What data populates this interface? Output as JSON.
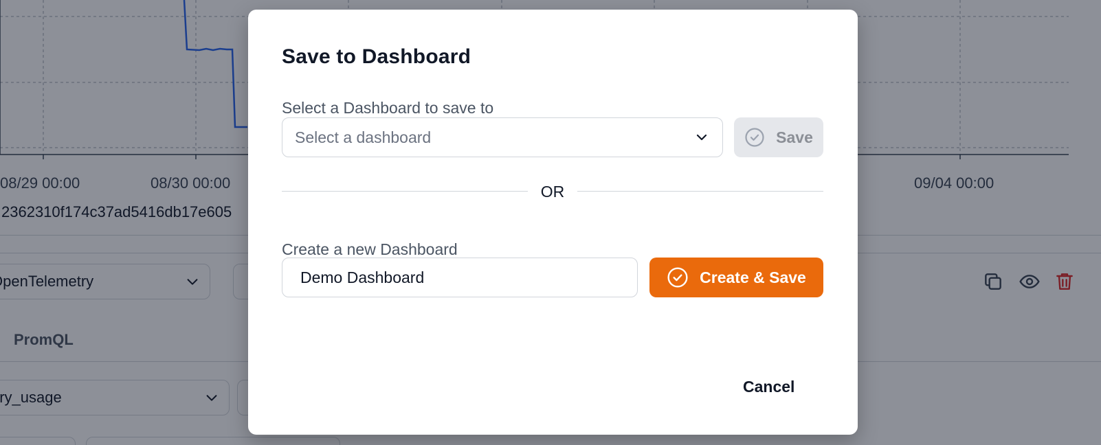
{
  "background": {
    "x_ticks": [
      "08/29 00:00",
      "08/30 00:00",
      "09/04 00:00"
    ],
    "series_id": "2362310f174c37ad5416db17e605",
    "data_source_select": "OpenTelemetry",
    "query_tab": "PromQL",
    "metric_select": "ory_usage",
    "colors": {
      "line": "#2563eb",
      "delete": "#dc2626"
    },
    "icons": [
      "copy-icon",
      "eye-icon",
      "trash-icon"
    ]
  },
  "modal": {
    "title": "Save to Dashboard",
    "select_label": "Select a Dashboard to save to",
    "select_placeholder": "Select a dashboard",
    "save_label": "Save",
    "or_text": "OR",
    "create_label": "Create a new Dashboard",
    "create_input_value": "Demo Dashboard",
    "create_button_label": "Create & Save",
    "cancel_label": "Cancel",
    "colors": {
      "accent": "#ea6a0c",
      "disabled": "#e5e7eb"
    }
  }
}
